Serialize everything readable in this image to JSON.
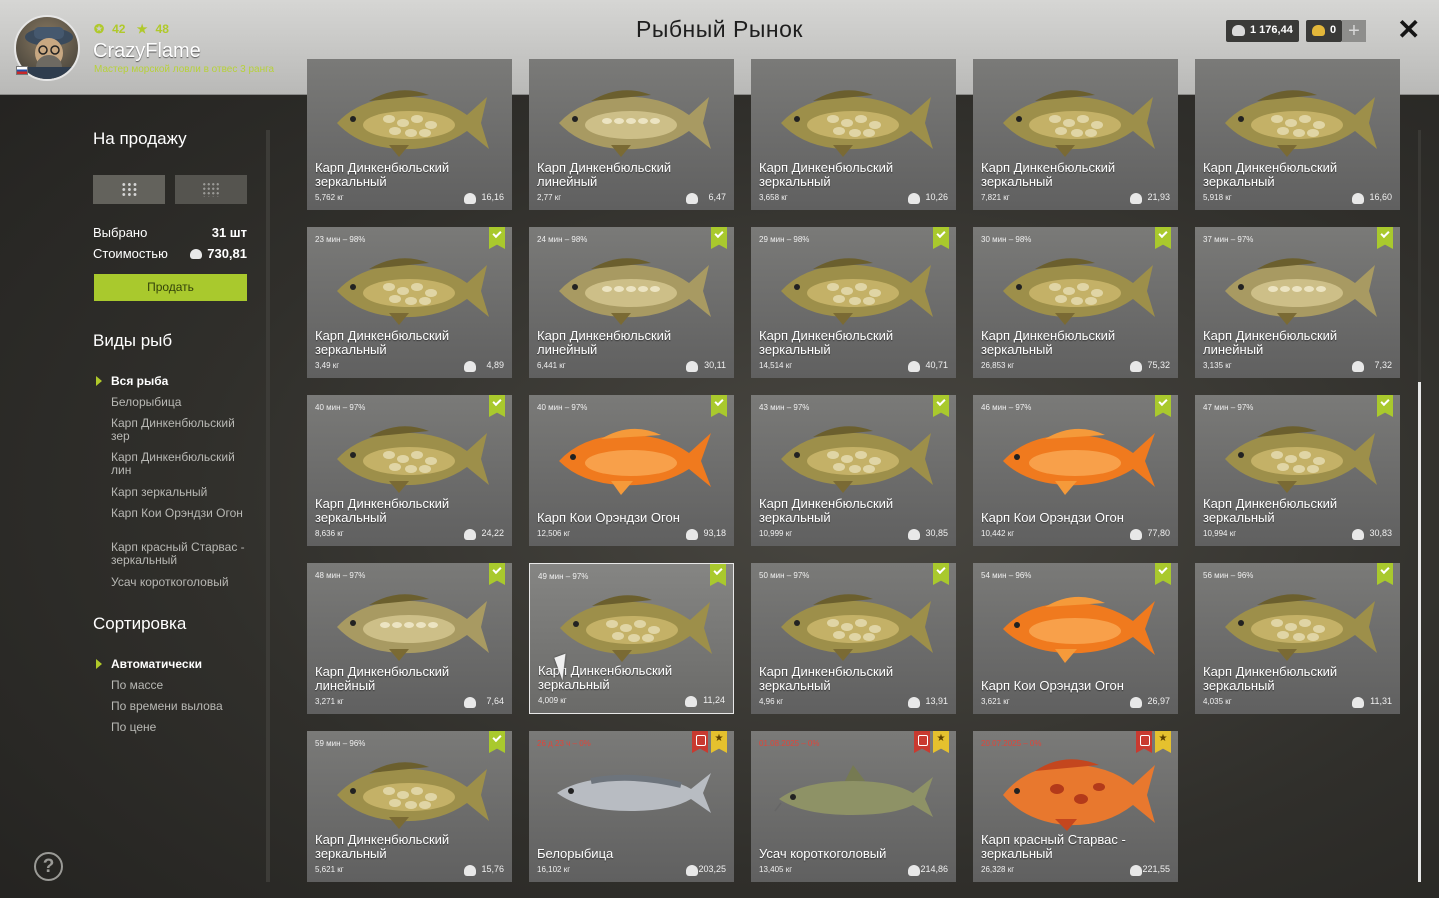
{
  "header": {
    "title": "Рыбный Рынок",
    "username": "CrazyFlame",
    "rank": "Мастер морской ловли в отвес 3 ранга",
    "level": "42",
    "stars": "48",
    "silver": "1 176,44",
    "gold": "0",
    "plus": "+",
    "close": "✕"
  },
  "sidebar": {
    "sale_title": "На продажу",
    "selected_label": "Выбрано",
    "selected_value": "31 шт",
    "cost_label": "Стоимостью",
    "cost_value": "730,81",
    "sell_button": "Продать",
    "species_title": "Виды рыб",
    "species": [
      "Вся рыба",
      "Белорыбица",
      "Карп Динкенбюльский зер",
      "Карп Динкенбюльский лин",
      "Карп зеркальный",
      "Карп Кои Орэндзи Огон",
      "Карп красный Старвас - зеркальный",
      "Усач короткоголовый"
    ],
    "sort_title": "Сортировка",
    "sorts": [
      "Автоматически",
      "По массе",
      "По времени вылова",
      "По цене"
    ],
    "help": "?"
  },
  "cards": [
    {
      "time": "",
      "name": "Карп Динкенбюльский зеркальный",
      "weight": "5,762 кг",
      "price": "16,16",
      "fish": "carp",
      "tag": "none"
    },
    {
      "time": "",
      "name": "Карп Динкенбюльский линейный",
      "weight": "2,77 кг",
      "price": "6,47",
      "fish": "carp-linear",
      "tag": "none"
    },
    {
      "time": "",
      "name": "Карп Динкенбюльский зеркальный",
      "weight": "3,658 кг",
      "price": "10,26",
      "fish": "carp",
      "tag": "none"
    },
    {
      "time": "",
      "name": "Карп Динкенбюльский зеркальный",
      "weight": "7,821 кг",
      "price": "21,93",
      "fish": "carp",
      "tag": "none"
    },
    {
      "time": "",
      "name": "Карп Динкенбюльский зеркальный",
      "weight": "5,918 кг",
      "price": "16,60",
      "fish": "carp",
      "tag": "none"
    },
    {
      "time": "23 мин – 98%",
      "name": "Карп Динкенбюльский зеркальный",
      "weight": "3,49 кг",
      "price": "4,89",
      "fish": "carp",
      "tag": "check"
    },
    {
      "time": "24 мин – 98%",
      "name": "Карп Динкенбюльский линейный",
      "weight": "6,441 кг",
      "price": "30,11",
      "fish": "carp-linear",
      "tag": "check"
    },
    {
      "time": "29 мин – 98%",
      "name": "Карп Динкенбюльский зеркальный",
      "weight": "14,514 кг",
      "price": "40,71",
      "fish": "carp",
      "tag": "check"
    },
    {
      "time": "30 мин – 98%",
      "name": "Карп Динкенбюльский зеркальный",
      "weight": "26,853 кг",
      "price": "75,32",
      "fish": "carp",
      "tag": "check"
    },
    {
      "time": "37 мин – 97%",
      "name": "Карп Динкенбюльский линейный",
      "weight": "3,135 кг",
      "price": "7,32",
      "fish": "carp-linear",
      "tag": "check"
    },
    {
      "time": "40 мин – 97%",
      "name": "Карп Динкенбюльский зеркальный",
      "weight": "8,636 кг",
      "price": "24,22",
      "fish": "carp",
      "tag": "check"
    },
    {
      "time": "40 мин – 97%",
      "name": "Карп Кои Орэндзи Огон",
      "weight": "12,506 кг",
      "price": "93,18",
      "fish": "koi",
      "tag": "check"
    },
    {
      "time": "43 мин – 97%",
      "name": "Карп Динкенбюльский зеркальный",
      "weight": "10,999 кг",
      "price": "30,85",
      "fish": "carp",
      "tag": "check"
    },
    {
      "time": "46 мин – 97%",
      "name": "Карп Кои Орэндзи Огон",
      "weight": "10,442 кг",
      "price": "77,80",
      "fish": "koi",
      "tag": "check"
    },
    {
      "time": "47 мин – 97%",
      "name": "Карп Динкенбюльский зеркальный",
      "weight": "10,994 кг",
      "price": "30,83",
      "fish": "carp",
      "tag": "check"
    },
    {
      "time": "48 мин – 97%",
      "name": "Карп Динкенбюльский линейный",
      "weight": "3,271 кг",
      "price": "7,64",
      "fish": "carp-linear",
      "tag": "check"
    },
    {
      "time": "49 мин – 97%",
      "name": "Карп Динкенбюльский зеркальный",
      "weight": "4,009 кг",
      "price": "11,24",
      "fish": "carp",
      "tag": "check",
      "selected": true
    },
    {
      "time": "50 мин – 97%",
      "name": "Карп Динкенбюльский зеркальный",
      "weight": "4,96 кг",
      "price": "13,91",
      "fish": "carp",
      "tag": "check"
    },
    {
      "time": "54 мин – 96%",
      "name": "Карп Кои Орэндзи Огон",
      "weight": "3,621 кг",
      "price": "26,97",
      "fish": "koi",
      "tag": "check"
    },
    {
      "time": "56 мин – 96%",
      "name": "Карп Динкенбюльский зеркальный",
      "weight": "4,035 кг",
      "price": "11,31",
      "fish": "carp",
      "tag": "check"
    },
    {
      "time": "59 мин – 96%",
      "name": "Карп Динкенбюльский зеркальный",
      "weight": "5,621 кг",
      "price": "15,76",
      "fish": "carp",
      "tag": "check"
    },
    {
      "time": "26 д 23 ч – 0%",
      "name": "Белорыбица",
      "weight": "16,102 кг",
      "price": "203,25",
      "fish": "whitefish",
      "tag": "trophy",
      "red": true
    },
    {
      "time": "01.08.2025 – 0%",
      "name": "Усач короткоголовый",
      "weight": "13,405 кг",
      "price": "214,86",
      "fish": "barbel",
      "tag": "trophy",
      "red": true
    },
    {
      "time": "20.07.2025 – 0%",
      "name": "Карп красный Старвас - зеркальный",
      "weight": "26,328 кг",
      "price": "221,55",
      "fish": "redcarp",
      "tag": "trophy",
      "red": true
    }
  ],
  "colors": {
    "accent": "#a9c92d",
    "star": "#e5c12e",
    "red": "#c93a30"
  }
}
